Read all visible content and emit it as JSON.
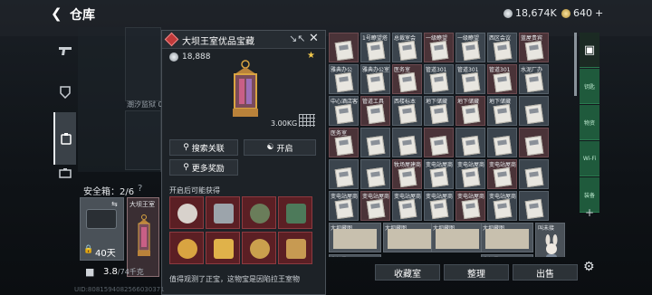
{
  "header": {
    "back_icon": "chevron-left-icon",
    "title": "仓库",
    "silver": "18,674K",
    "gold": "640",
    "gold_plus": "+"
  },
  "nav": [
    "pistol-icon",
    "armor-icon",
    "backpack-icon",
    "briefcase-icon"
  ],
  "stash": {
    "tide_label": "潮汐监狱 0/"
  },
  "safe": {
    "title": "安全箱：2/6",
    "help": "?",
    "days": "40天",
    "lantern_label": "大坝王室"
  },
  "weight": {
    "value": "3.8",
    "unit": "/74千克"
  },
  "popup": {
    "title": "大坝王室优品宝藏",
    "price": "18,888",
    "weight": "3.00KG",
    "buttons": {
      "search": "搜索关联",
      "open": "开启",
      "more": "更多奖励"
    },
    "reward_label": "开启后可能获得",
    "rewards": [
      {
        "icon": "bunny-figure-icon",
        "color": "#d8d2cc"
      },
      {
        "icon": "knife-icon",
        "color": "#9ca4ab"
      },
      {
        "icon": "ammo-box-icon",
        "color": "#6a7d5a"
      },
      {
        "icon": "card-icon",
        "color": "#4d7a5a"
      },
      {
        "icon": "ring-icon",
        "color": "#d9a441"
      },
      {
        "icon": "gold-bar-icon",
        "color": "#e0b24a"
      },
      {
        "icon": "watch-icon",
        "color": "#caa04d"
      },
      {
        "icon": "compass-icon",
        "color": "#c79a52"
      }
    ],
    "footer": "值得观测了正宝，这物宝是因陷拉王室物"
  },
  "grid": {
    "cells": [
      [
        "",
        "1号瞭望塔",
        "总裁室会",
        "一级瞭望",
        "一级瞭望",
        "西区会议",
        "蓝屋贵宾"
      ],
      [
        "雅典办公",
        "雅典办公室",
        "医务室",
        "管道301",
        "管道301",
        "管道301",
        "水泥厂办"
      ],
      [
        "中心酒店客",
        "管道工具",
        "西楼标本",
        "地下储藏",
        "地下储藏",
        "地下储藏",
        ""
      ],
      [
        "医务室",
        "",
        "",
        "",
        "",
        "",
        ""
      ],
      [
        "",
        "",
        "牧场屋建商",
        "变电站屋商",
        "变电站屋商",
        "变电站屋商",
        ""
      ],
      [
        "变电站屋商",
        "变电站屋商",
        "变电站屋商",
        "变电站屋商",
        "变电站屋商",
        "变电站屋商",
        ""
      ]
    ],
    "maps": [
      "大坝藏图",
      "大坝藏图",
      "大坝藏图",
      "大坝藏图",
      "大坝藏图",
      "大坝藏图"
    ],
    "bunny_label": "叫未接"
  },
  "right_tabs": [
    "钥匙",
    "物资",
    "Wi-Fi",
    "装备"
  ],
  "bottom": {
    "collect": "收藏室",
    "sort": "整理",
    "sell": "出售"
  },
  "uid": "UID:8081594082566030371"
}
